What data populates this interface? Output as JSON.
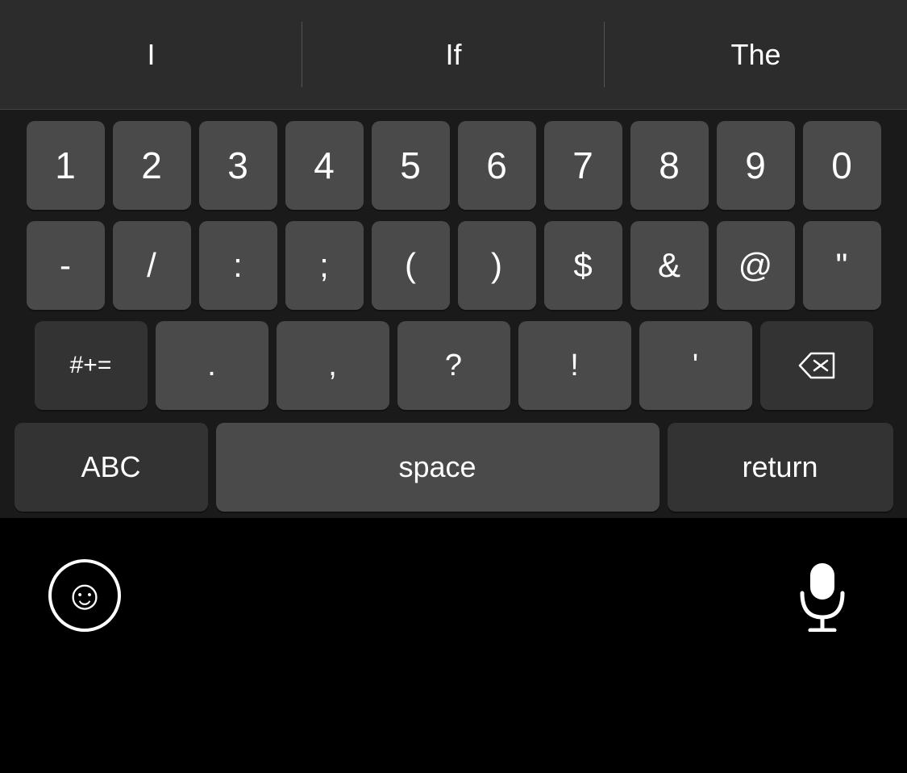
{
  "autocomplete": {
    "items": [
      {
        "id": "autocomplete-I",
        "label": "I"
      },
      {
        "id": "autocomplete-If",
        "label": "If"
      },
      {
        "id": "autocomplete-The",
        "label": "The"
      }
    ]
  },
  "keyboard": {
    "number_row": [
      {
        "key": "1"
      },
      {
        "key": "2"
      },
      {
        "key": "3"
      },
      {
        "key": "4"
      },
      {
        "key": "5"
      },
      {
        "key": "6"
      },
      {
        "key": "7"
      },
      {
        "key": "8"
      },
      {
        "key": "9"
      },
      {
        "key": "0"
      }
    ],
    "symbol_row": [
      {
        "key": "-"
      },
      {
        "key": "/"
      },
      {
        "key": ":"
      },
      {
        "key": ";"
      },
      {
        "key": "("
      },
      {
        "key": ")"
      },
      {
        "key": "$"
      },
      {
        "key": "&"
      },
      {
        "key": "@"
      },
      {
        "key": "\""
      }
    ],
    "third_row": {
      "hashtag_label": "#+=",
      "dot_label": ".",
      "comma_label": ",",
      "question_label": "?",
      "exclaim_label": "!",
      "apostrophe_label": "'"
    },
    "bottom_row": {
      "abc_label": "ABC",
      "space_label": "space",
      "return_label": "return"
    }
  }
}
